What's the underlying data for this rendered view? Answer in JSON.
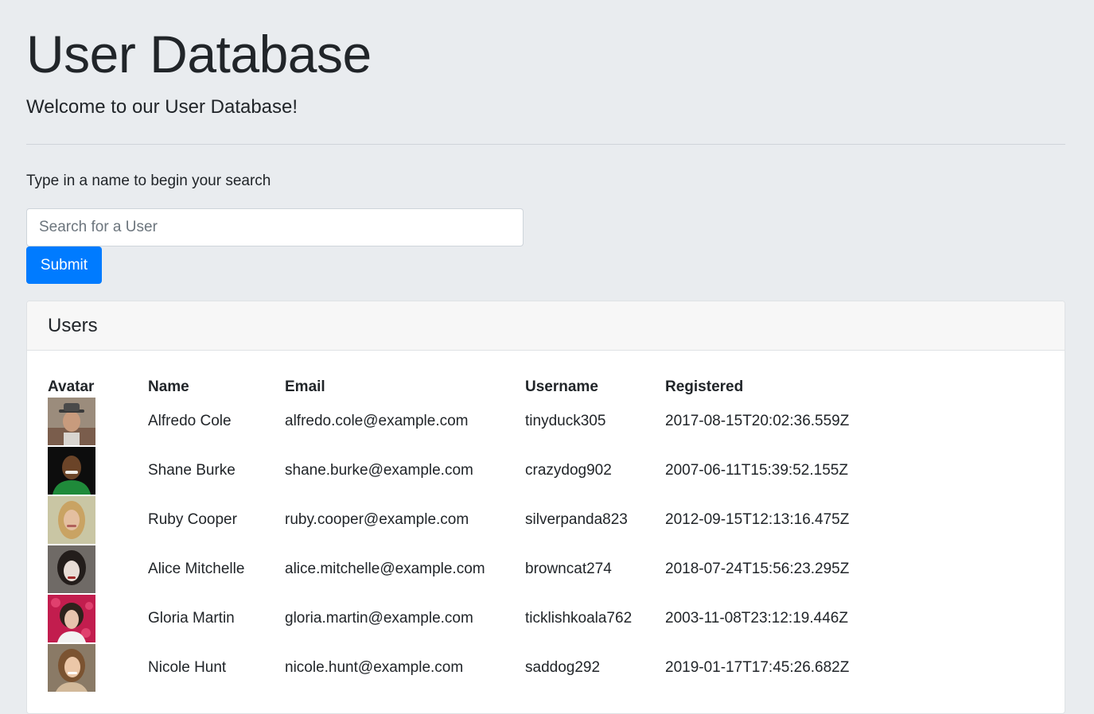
{
  "header": {
    "title": "User Database",
    "subtitle": "Welcome to our User Database!"
  },
  "search": {
    "prompt": "Type in a name to begin your search",
    "placeholder": "Search for a User",
    "value": "",
    "submit_label": "Submit"
  },
  "users_card": {
    "title": "Users",
    "columns": [
      "Avatar",
      "Name",
      "Email",
      "Username",
      "Registered"
    ],
    "rows": [
      {
        "avatar": "avatar-photo-man-hat",
        "name": "Alfredo Cole",
        "email": "alfredo.cole@example.com",
        "username": "tinyduck305",
        "registered": "2017-08-15T20:02:36.559Z"
      },
      {
        "avatar": "avatar-photo-man-green-shirt",
        "name": "Shane Burke",
        "email": "shane.burke@example.com",
        "username": "crazydog902",
        "registered": "2007-06-11T15:39:52.155Z"
      },
      {
        "avatar": "avatar-photo-woman-blonde",
        "name": "Ruby Cooper",
        "email": "ruby.cooper@example.com",
        "username": "silverpanda823",
        "registered": "2012-09-15T12:13:16.475Z"
      },
      {
        "avatar": "avatar-photo-woman-dark-hair",
        "name": "Alice Mitchelle",
        "email": "alice.mitchelle@example.com",
        "username": "browncat274",
        "registered": "2018-07-24T15:56:23.295Z"
      },
      {
        "avatar": "avatar-photo-woman-pink-background",
        "name": "Gloria Martin",
        "email": "gloria.martin@example.com",
        "username": "ticklishkoala762",
        "registered": "2003-11-08T23:12:19.446Z"
      },
      {
        "avatar": "avatar-photo-woman-smiling",
        "name": "Nicole Hunt",
        "email": "nicole.hunt@example.com",
        "username": "saddog292",
        "registered": "2019-01-17T17:45:26.682Z"
      }
    ]
  },
  "colors": {
    "page_background": "#e9ecef",
    "primary_button": "#007bff",
    "card_header": "#f7f7f7"
  }
}
